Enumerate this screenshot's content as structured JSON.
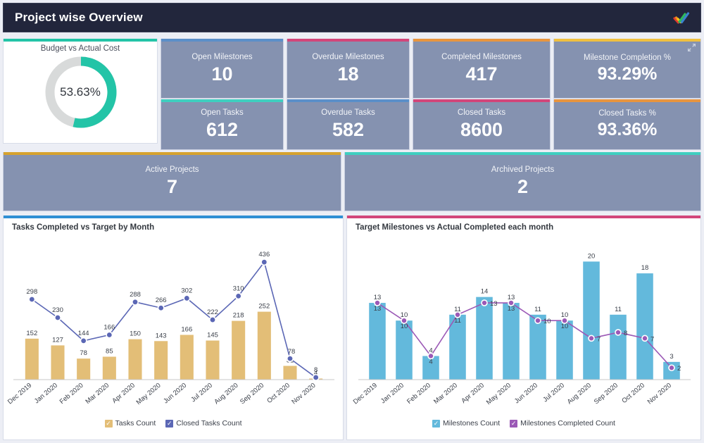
{
  "header": {
    "title": "Project wise Overview",
    "logo_icon": "checkmark-logo-icon",
    "bg_color": "#22263c"
  },
  "donut": {
    "title": "Budget vs Actual Cost",
    "value_label": "53.63%",
    "percent": 53.63,
    "arc_color": "#23c4a7",
    "track_color": "#d8dada",
    "accent_color": "#23c4a7"
  },
  "kpis": [
    {
      "label": "Open Milestones",
      "value": "10",
      "accent": "#5b8fc9"
    },
    {
      "label": "Overdue Milestones",
      "value": "18",
      "accent": "#d2467a"
    },
    {
      "label": "Completed Milestones",
      "value": "417",
      "accent": "#e8953f"
    },
    {
      "label": "Milestone Completion %",
      "value": "93.29%",
      "accent": "#f0c040",
      "expand_icon": "expand-arrow-icon"
    },
    {
      "label": "Open Tasks",
      "value": "612",
      "accent": "#3fcfc0"
    },
    {
      "label": "Overdue Tasks",
      "value": "582",
      "accent": "#5b8fc9"
    },
    {
      "label": "Closed Tasks",
      "value": "8600",
      "accent": "#d2467a"
    },
    {
      "label": "Closed Tasks %",
      "value": "93.36%",
      "accent": "#e8953f"
    }
  ],
  "project_cards": [
    {
      "label": "Active Projects",
      "value": "7",
      "accent": "#d6a22e"
    },
    {
      "label": "Archived Projects",
      "value": "2",
      "accent": "#3fcfc0"
    }
  ],
  "charts": {
    "left": {
      "accent": "#2f8fd4"
    },
    "right": {
      "accent": "#d2467a"
    }
  },
  "chart_data": [
    {
      "type": "bar",
      "id": "tasks-completed-vs-target",
      "title": "Tasks Completed vs Target by Month",
      "xlabel": "",
      "ylabel": "",
      "grid": false,
      "legend_position": "bottom",
      "categories": [
        "Dec 2019",
        "Jan 2020",
        "Feb 2020",
        "Mar 2020",
        "Apr 2020",
        "May 2020",
        "Jun 2020",
        "Jul 2020",
        "Aug 2020",
        "Sep 2020",
        "Oct 2020",
        "Nov 2020"
      ],
      "ylim": [
        0,
        460
      ],
      "series": [
        {
          "name": "Tasks Count",
          "kind": "bar",
          "color": "#e3be77",
          "values": [
            152,
            127,
            78,
            85,
            150,
            143,
            166,
            145,
            218,
            252,
            51,
            4
          ]
        },
        {
          "name": "Closed Tasks Count",
          "kind": "line",
          "color": "#5b67b5",
          "values": [
            298,
            230,
            144,
            166,
            288,
            266,
            302,
            222,
            310,
            436,
            78,
            8
          ]
        }
      ]
    },
    {
      "type": "bar",
      "id": "target-milestones-vs-actual",
      "title": "Target Milestones vs Actual Completed each month",
      "xlabel": "",
      "ylabel": "",
      "grid": false,
      "legend_position": "bottom",
      "categories": [
        "Dec 2019",
        "Jan 2020",
        "Feb 2020",
        "Mar 2020",
        "Apr 2020",
        "May 2020",
        "Jun 2020",
        "Jul 2020",
        "Aug 2020",
        "Sep 2020",
        "Oct 2020",
        "Nov 2020"
      ],
      "ylim": [
        0,
        21
      ],
      "series": [
        {
          "name": "Milestones Count",
          "kind": "bar",
          "color": "#63b9dc",
          "values": [
            13,
            10,
            4,
            11,
            14,
            13,
            11,
            10,
            20,
            11,
            18,
            3
          ]
        },
        {
          "name": "Milestones Completed Count",
          "kind": "line",
          "color": "#9b59b6",
          "values": [
            13,
            10,
            4,
            11,
            13,
            13,
            10,
            10,
            7,
            8,
            7,
            2
          ]
        }
      ]
    }
  ]
}
